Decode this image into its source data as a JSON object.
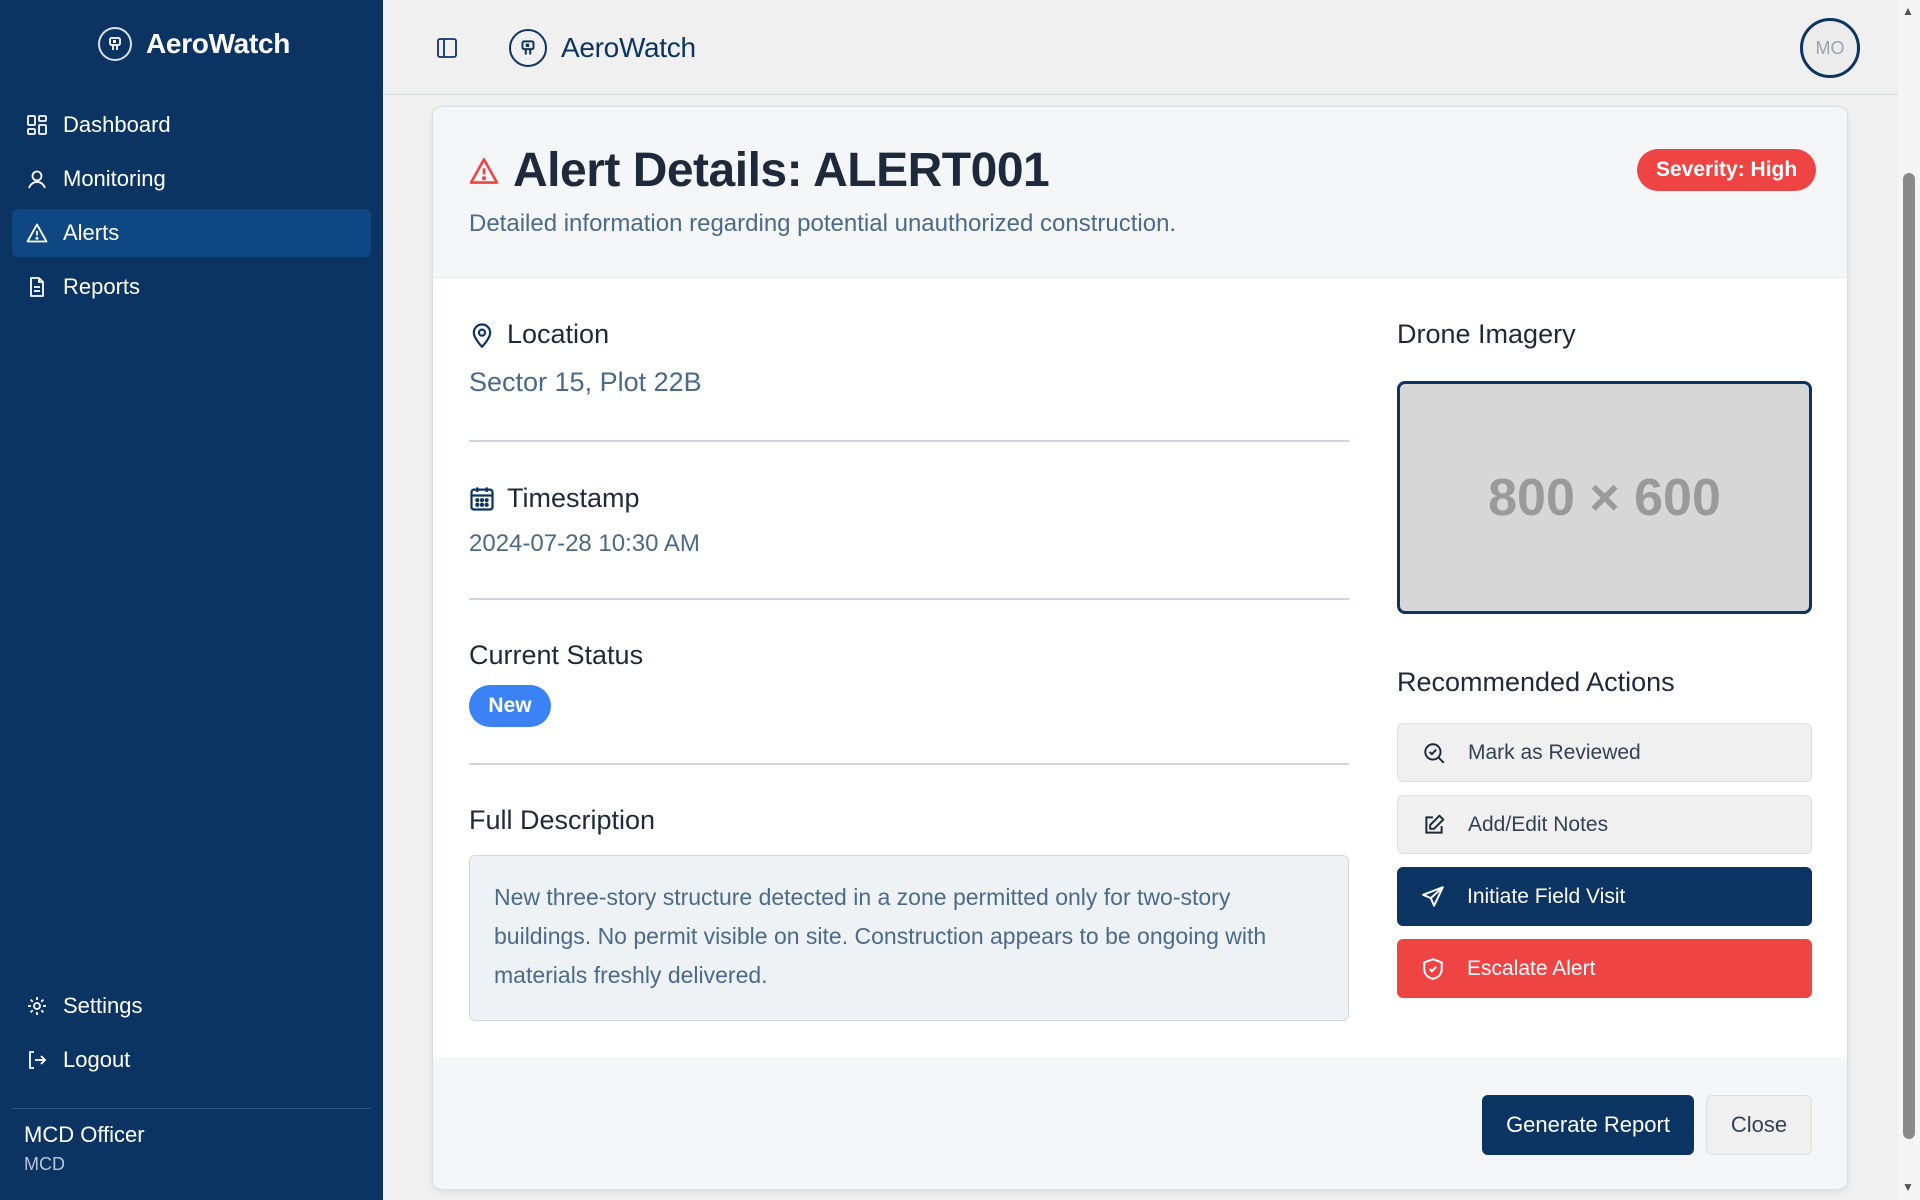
{
  "app": {
    "name": "AeroWatch"
  },
  "sidebar": {
    "items": [
      {
        "label": "Dashboard",
        "icon": "dashboard-grid-icon"
      },
      {
        "label": "Monitoring",
        "icon": "user-icon"
      },
      {
        "label": "Alerts",
        "icon": "alert-triangle-icon",
        "active": true
      },
      {
        "label": "Reports",
        "icon": "document-icon"
      }
    ],
    "bottom_items": [
      {
        "label": "Settings",
        "icon": "gear-icon"
      },
      {
        "label": "Logout",
        "icon": "logout-icon"
      }
    ],
    "user": {
      "name": "MCD Officer",
      "org": "MCD"
    }
  },
  "topbar": {
    "brand": "AeroWatch",
    "avatar_initials": "MO"
  },
  "alert": {
    "title": "Alert Details: ALERT001",
    "subtitle": "Detailed information regarding potential unauthorized construction.",
    "severity": "Severity: High",
    "location_label": "Location",
    "location": "Sector 15, Plot 22B",
    "timestamp_label": "Timestamp",
    "timestamp": "2024-07-28 10:30 AM",
    "status_label": "Current Status",
    "status": "New",
    "description_label": "Full Description",
    "description": "New three-story structure detected in a zone permitted only for two-story buildings. No permit visible on site. Construction appears to be ongoing with materials freshly delivered.",
    "imagery_label": "Drone Imagery",
    "imagery_placeholder": "800 × 600",
    "actions_label": "Recommended Actions",
    "actions": [
      {
        "label": "Mark as Reviewed",
        "icon": "search-check-icon"
      },
      {
        "label": "Add/Edit Notes",
        "icon": "edit-icon"
      },
      {
        "label": "Initiate Field Visit",
        "icon": "send-icon"
      },
      {
        "label": "Escalate Alert",
        "icon": "shield-alert-icon"
      }
    ]
  },
  "footer": {
    "generate_label": "Generate Report",
    "close_label": "Close"
  },
  "colors": {
    "sidebar_bg": "#0b3463",
    "active_nav": "#0f4782",
    "danger": "#ef4444",
    "status_blue": "#3b82f6"
  }
}
